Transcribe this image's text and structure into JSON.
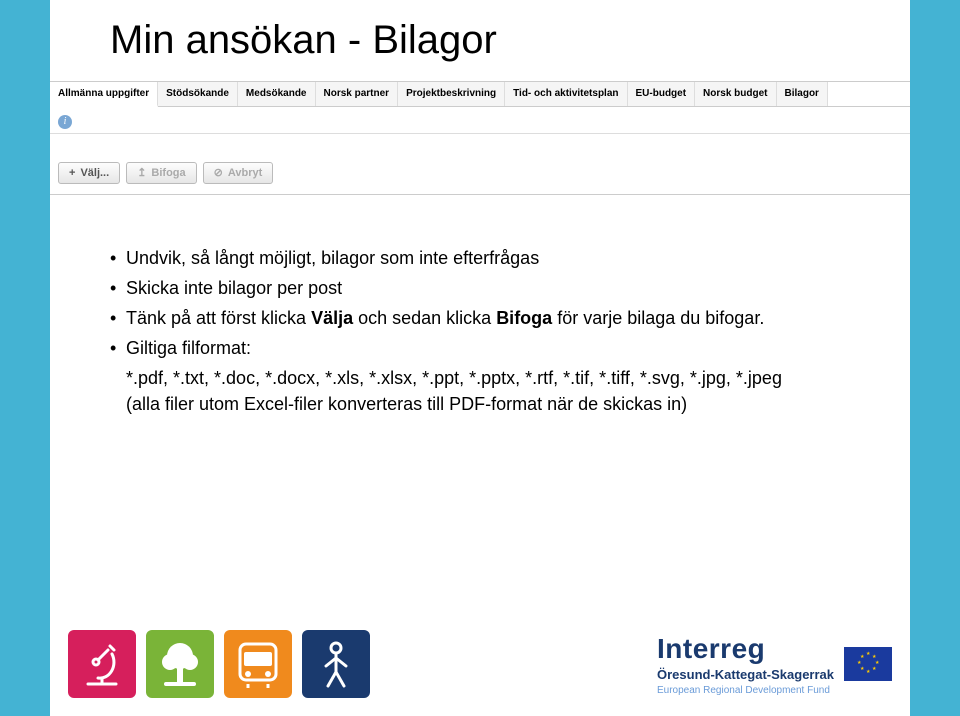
{
  "title": "Min ansökan - Bilagor",
  "tabs": [
    "Allmänna uppgifter",
    "Stödsökande",
    "Medsökande",
    "Norsk partner",
    "Projektbeskrivning",
    "Tid- och aktivitetsplan",
    "EU-budget",
    "Norsk budget",
    "Bilagor"
  ],
  "activeTabIndex": 0,
  "toolbar": {
    "select": "Välj...",
    "attach": "Bifoga",
    "cancel": "Avbryt"
  },
  "bullets": {
    "b1": "Undvik, så långt möjligt, bilagor som inte efterfrågas",
    "b2": "Skicka inte bilagor per post",
    "b3_pre": "Tänk på att först klicka ",
    "b3_w1": "Välja",
    "b3_mid": " och sedan klicka ",
    "b3_w2": "Bifoga",
    "b3_post": " för varje bilaga du bifogar.",
    "b4": "Giltiga filformat:",
    "ext1": "*.pdf, *.txt, *.doc, *.docx, *.xls, *.xlsx, *.ppt, *.pptx, *.rtf, *.tif, *.tiff, *.svg, *.jpg, *.jpeg",
    "ext2": "(alla filer utom Excel-filer konverteras till PDF-format när de skickas in)"
  },
  "badges": [
    {
      "name": "microscope",
      "bg": "#d61f5c"
    },
    {
      "name": "tree",
      "bg": "#7ab438"
    },
    {
      "name": "bus",
      "bg": "#f08a1d"
    },
    {
      "name": "person",
      "bg": "#1a3a6e"
    }
  ],
  "brand": {
    "title": "Interreg",
    "sub": "Öresund-Kattegat-Skagerrak",
    "tag": "European Regional Development Fund"
  }
}
